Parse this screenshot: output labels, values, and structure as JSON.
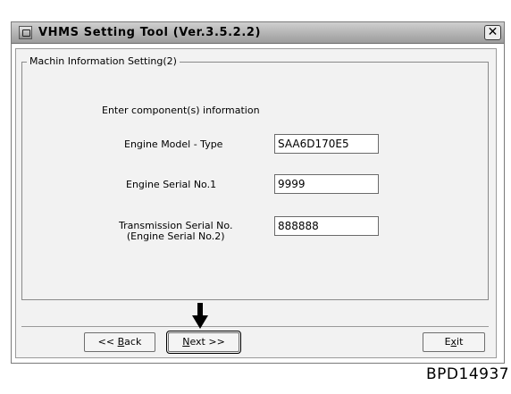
{
  "window": {
    "title": "VHMS Setting Tool  (Ver.3.5.2.2)",
    "close_glyph": "✕"
  },
  "group": {
    "legend": "Machin Information Setting(2)"
  },
  "form": {
    "instruction": "Enter component(s) information",
    "fields": [
      {
        "label_lines": [
          "Engine Model - Type"
        ],
        "value": "SAA6D170E5"
      },
      {
        "label_lines": [
          "Engine Serial No.1"
        ],
        "value": "9999"
      },
      {
        "label_lines": [
          "Transmission Serial No.",
          "(Engine Serial No.2)"
        ],
        "value": "888888"
      }
    ]
  },
  "buttons": {
    "back": {
      "prefix": "<< ",
      "mnemonic": "B",
      "rest": "ack"
    },
    "next": {
      "mnemonic": "N",
      "rest": "ext >>"
    },
    "exit": {
      "prefix": "E",
      "mnemonic": "x",
      "rest": "it"
    }
  },
  "annotation": {
    "arrow_icon": "down-arrow-icon",
    "reference_code": "BPD14937"
  }
}
